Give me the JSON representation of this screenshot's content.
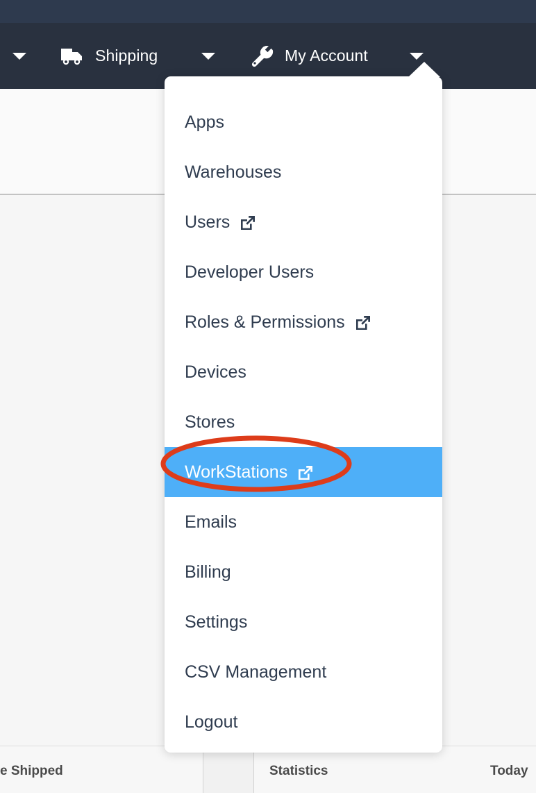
{
  "navbar": {
    "background_color": "#29313f",
    "topbar_color": "#2e3a4e",
    "items": [
      {
        "icon": "chevron-down-icon",
        "label": ""
      },
      {
        "icon": "truck-icon",
        "label": "Shipping"
      },
      {
        "icon": "chevron-down-icon",
        "label": ""
      },
      {
        "icon": "wrench-icon",
        "label": "My Account"
      },
      {
        "icon": "chevron-down-icon",
        "label": ""
      }
    ],
    "shipping_label": "Shipping",
    "account_label": "My Account"
  },
  "dropdown": {
    "owner": "My Account",
    "highlight_color": "#4eaff8",
    "items": [
      {
        "label": "Apps",
        "external": false,
        "active": false
      },
      {
        "label": "Warehouses",
        "external": false,
        "active": false
      },
      {
        "label": "Users",
        "external": true,
        "active": false
      },
      {
        "label": "Developer Users",
        "external": false,
        "active": false
      },
      {
        "label": "Roles & Permissions",
        "external": true,
        "active": false
      },
      {
        "label": "Devices",
        "external": false,
        "active": false
      },
      {
        "label": "Stores",
        "external": false,
        "active": false
      },
      {
        "label": "WorkStations",
        "external": true,
        "active": true
      },
      {
        "label": "Emails",
        "external": false,
        "active": false
      },
      {
        "label": "Billing",
        "external": false,
        "active": false
      },
      {
        "label": "Settings",
        "external": false,
        "active": false
      },
      {
        "label": "CSV Management",
        "external": false,
        "active": false
      },
      {
        "label": "Logout",
        "external": false,
        "active": false
      }
    ]
  },
  "annotation": {
    "shape": "ellipse",
    "color": "#dd3c1a",
    "target_label": "WorkStations"
  },
  "background_panels": {
    "shipped_title": "e Shipped",
    "statistics_title": "Statistics",
    "today_title": "Today"
  }
}
